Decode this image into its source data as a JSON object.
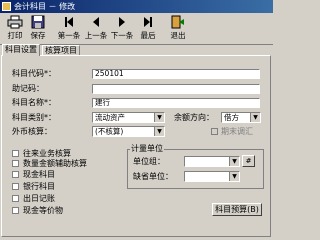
{
  "window": {
    "title": "会计科目 － 修改"
  },
  "toolbar": {
    "print": "打印",
    "save": "保存",
    "first": "第一条",
    "prev": "上一条",
    "next": "下一条",
    "last": "最后",
    "exit": "退出"
  },
  "tabs": {
    "settings": "科目设置",
    "checking": "核算项目"
  },
  "form": {
    "code_label": "科目代码*：",
    "code_value": "250101",
    "mnemonic_label": "助记码：",
    "mnemonic_value": "",
    "name_label": "科目名称*：",
    "name_value": "建行",
    "type_label": "科目类别*：",
    "type_value": "流动资产",
    "direction_label": "余额方向：",
    "direction_value": "借方",
    "currency_label": "外币核算：",
    "currency_value": "(不核算)",
    "period_adjust_label": "期末调汇"
  },
  "checks": {
    "contact": "往来业务核算",
    "quantity": "数量金额辅助核算",
    "cash": "现金科目",
    "bank": "银行科目",
    "journal": "出日记账",
    "cash_equiv": "现金等价物"
  },
  "unit_group": {
    "title": "计量单位",
    "unit_group_label": "单位组：",
    "default_unit_label": "缺省单位：",
    "browse_icon": "ellipsis-icon"
  },
  "buttons": {
    "budget": "科目预算(B)"
  },
  "colors": {
    "title_start": "#0a246a",
    "title_end": "#3a6ea5",
    "face": "#d4d0c8"
  }
}
